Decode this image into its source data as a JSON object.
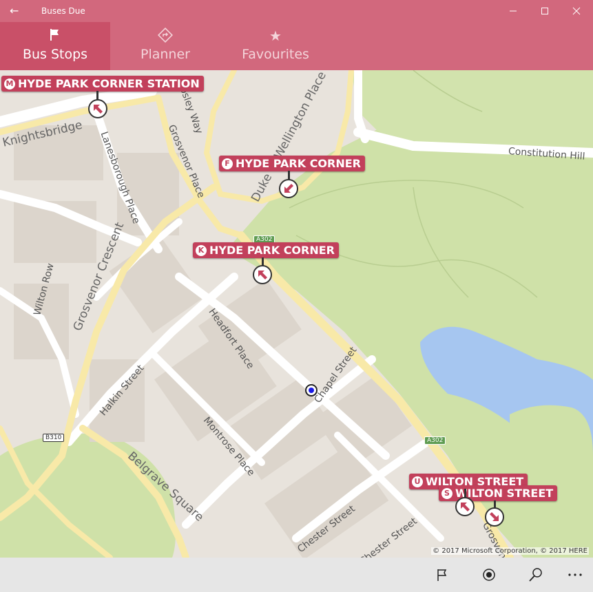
{
  "window": {
    "title": "Buses Due"
  },
  "tabs": [
    {
      "label": "Bus Stops",
      "icon": "flag-icon"
    },
    {
      "label": "Planner",
      "icon": "directions-icon"
    },
    {
      "label": "Favourites",
      "icon": "star-icon"
    }
  ],
  "colors": {
    "accent": "#d2687d",
    "active_tab": "#c95068",
    "stop_label": "#c2405b",
    "park": "#cfe1a8",
    "water": "#a6c6f0"
  },
  "map": {
    "road_labels": [
      "Knightsbridge",
      "Lanesborough Place",
      "Grosvenor Place",
      "Apsley Way",
      "Duke of Wellington Place",
      "Constitution Hill",
      "Grosvenor Crescent",
      "Wilton Row",
      "Headfort Place",
      "Chapel Street",
      "Halkin Street",
      "Montrose Place",
      "Belgrave Square",
      "Chester Street",
      "Chester Street",
      "Grosvenor"
    ],
    "road_shields": [
      "A302",
      "A302",
      "B310"
    ],
    "copyright": "© 2017 Microsoft Corporation, © 2017 HERE"
  },
  "stops": [
    {
      "letter": "M",
      "name": "HYDE PARK CORNER STATION"
    },
    {
      "letter": "F",
      "name": "HYDE PARK CORNER"
    },
    {
      "letter": "K",
      "name": "HYDE PARK CORNER"
    },
    {
      "letter": "U",
      "name": "WILTON STREET"
    },
    {
      "letter": "S",
      "name": "WILTON STREET"
    }
  ],
  "bottombar": [
    "flag-icon",
    "location-icon",
    "search-icon",
    "more-icon"
  ]
}
